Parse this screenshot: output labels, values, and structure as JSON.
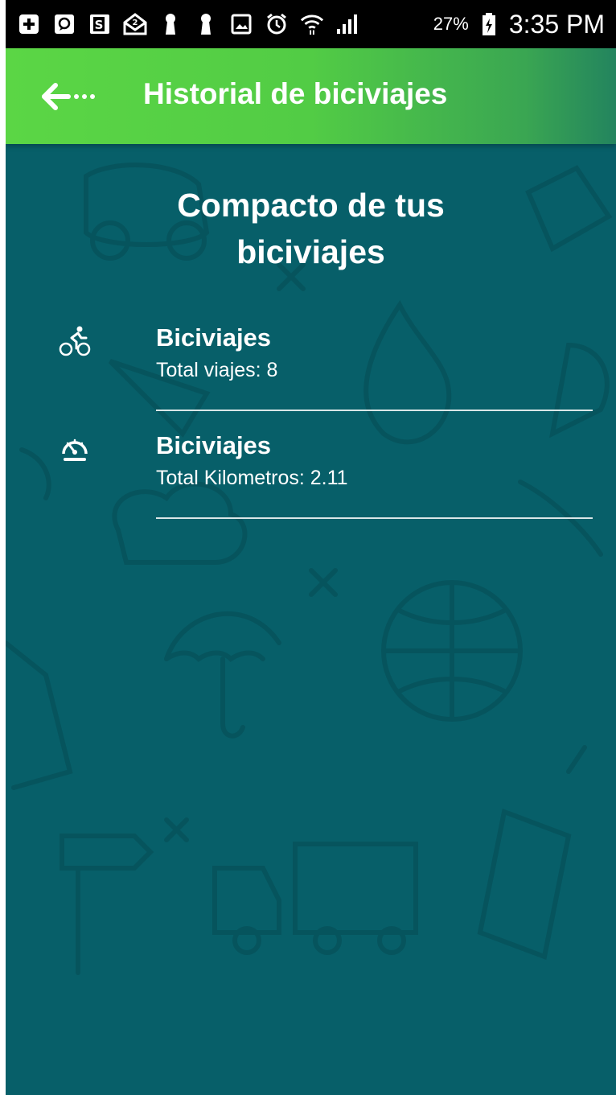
{
  "status_bar": {
    "battery_percent": "27%",
    "time": "3:35 PM",
    "icons": [
      "add-box-icon",
      "chat-bubble-icon",
      "s-app-icon",
      "mail-open-icon",
      "keyhole-icon",
      "keyhole-icon",
      "image-icon",
      "alarm-icon",
      "wifi-icon",
      "signal-icon",
      "battery-charging-icon"
    ]
  },
  "app_bar": {
    "title": "Historial de biciviajes",
    "back_icon": "back-arrow-icon"
  },
  "summary": {
    "heading_line1": "Compacto de tus",
    "heading_line2": "biciviajes"
  },
  "stats": [
    {
      "icon": "bicycle-rider-icon",
      "title": "Biciviajes",
      "subtitle": "Total viajes: 8"
    },
    {
      "icon": "speedometer-icon",
      "title": "Biciviajes",
      "subtitle": "Total Kilometros: 2.11"
    }
  ],
  "colors": {
    "background": "#075f69",
    "app_bar_start": "#5bd645",
    "app_bar_end": "#23845e",
    "text": "#ffffff",
    "divider": "#d9e6e7"
  }
}
